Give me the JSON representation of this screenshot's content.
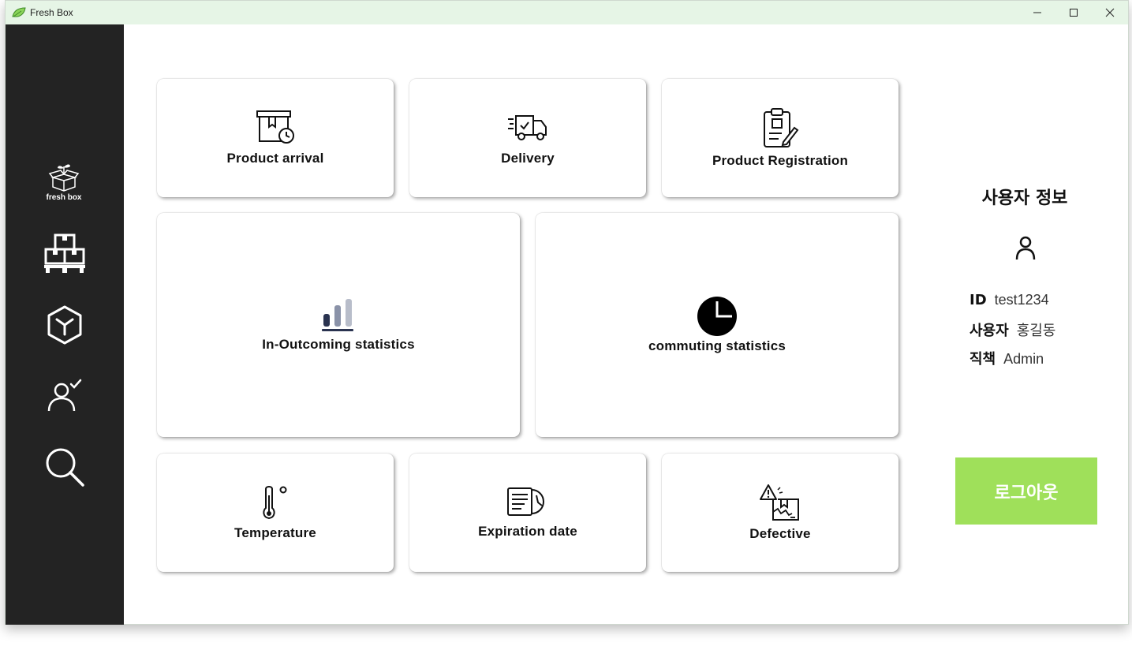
{
  "window": {
    "title": "Fresh Box",
    "controls": {
      "minimize": "minimize-icon",
      "maximize": "maximize-icon",
      "close": "close-icon"
    }
  },
  "sidebar": {
    "logo_text": "fresh box",
    "items": [
      {
        "icon": "pallet-boxes-icon"
      },
      {
        "icon": "cube-icon"
      },
      {
        "icon": "user-check-icon"
      },
      {
        "icon": "search-icon"
      }
    ]
  },
  "cards": {
    "product_arrival": "Product arrival",
    "delivery": "Delivery",
    "product_registration": "Product Registration",
    "in_outcoming": "In-Outcoming statistics",
    "commuting": "commuting statistics",
    "temperature": "Temperature",
    "expiration": "Expiration date",
    "defective": "Defective"
  },
  "user": {
    "title": "사용자 정보",
    "id_label": "ID",
    "id_value": "test1234",
    "name_label": "사용자",
    "name_value": "홍길동",
    "role_label": "직책",
    "role_value": "Admin",
    "logout_label": "로그아웃"
  },
  "colors": {
    "sidebar_bg": "#232323",
    "titlebar_bg": "#e6f5e6",
    "logout_bg": "#9fe05a",
    "chart_accent": "#2a3350"
  }
}
